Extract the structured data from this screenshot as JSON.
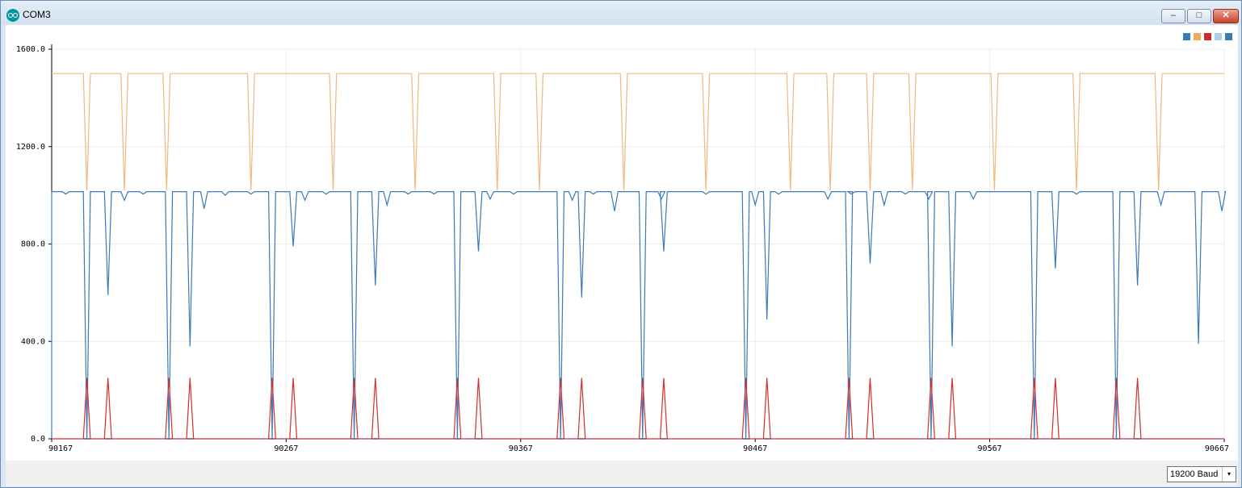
{
  "window": {
    "title": "COM3",
    "min_glyph": "–",
    "max_glyph": "□",
    "close_glyph": "✕"
  },
  "chart_data": {
    "type": "line",
    "ylim": [
      0,
      1600
    ],
    "xlim": [
      90167,
      90667
    ],
    "y_ticks": [
      "0.0",
      "400.0",
      "800.0",
      "1200.0",
      "1600.0"
    ],
    "x_ticks": [
      "90167",
      "90267",
      "90367",
      "90467",
      "90567",
      "90667"
    ],
    "legend_colors": [
      "#3a7ab8",
      "#f4a95a",
      "#d02a2a",
      "#a9d0ea",
      "#3a7ab8"
    ],
    "pulse_times": [
      90182,
      90217,
      90261,
      90296,
      90340,
      90384,
      90419,
      90463,
      90507,
      90542,
      90586,
      90621
    ],
    "second_offset": 9,
    "series": [
      {
        "color": "#f0b87a",
        "base": 1500,
        "dip": 1020,
        "dip_times": [
          90182,
          90198,
          90216,
          90252,
          90287,
          90322,
          90357,
          90375,
          90411,
          90446,
          90482,
          90499,
          90516,
          90534,
          90569,
          90604,
          90639
        ]
      },
      {
        "color": "#3a7ab8",
        "base": 1015,
        "first_dip": 0,
        "second_dips": [
          590,
          380,
          790,
          630,
          770,
          580,
          770,
          490,
          720,
          380,
          700,
          630,
          390
        ],
        "minor_dips": [
          [
            90173,
            1005
          ],
          [
            90198,
            980
          ],
          [
            90206,
            1005
          ],
          [
            90232,
            945
          ],
          [
            90241,
            1000
          ],
          [
            90252,
            1005
          ],
          [
            90275,
            980
          ],
          [
            90284,
            1005
          ],
          [
            90310,
            960
          ],
          [
            90319,
            1005
          ],
          [
            90330,
            1005
          ],
          [
            90354,
            985
          ],
          [
            90364,
            1005
          ],
          [
            90389,
            980
          ],
          [
            90398,
            1005
          ],
          [
            90407,
            935
          ],
          [
            90427,
            985
          ],
          [
            90446,
            1005
          ],
          [
            90467,
            960
          ],
          [
            90477,
            1005
          ],
          [
            90498,
            985
          ],
          [
            90508,
            1005
          ],
          [
            90522,
            960
          ],
          [
            90531,
            1005
          ],
          [
            90541,
            985
          ],
          [
            90560,
            985
          ],
          [
            90604,
            1005
          ],
          [
            90640,
            960
          ],
          [
            90666,
            935
          ]
        ]
      },
      {
        "color": "#d03030",
        "base": 0,
        "peak": 250
      }
    ]
  },
  "baud": {
    "value": "19200 Baud",
    "arrow": "▾"
  }
}
